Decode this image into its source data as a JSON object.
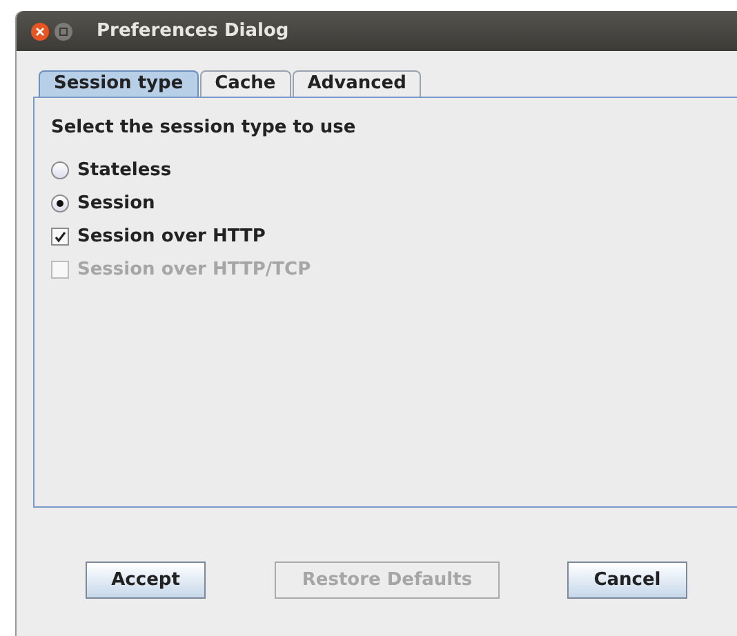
{
  "window": {
    "title": "Preferences Dialog"
  },
  "tabs": [
    {
      "label": "Session type",
      "selected": true
    },
    {
      "label": "Cache",
      "selected": false
    },
    {
      "label": "Advanced",
      "selected": false
    }
  ],
  "panel": {
    "heading": "Select the session type to use",
    "options": [
      {
        "kind": "radio",
        "label": "Stateless",
        "selected": false,
        "disabled": false
      },
      {
        "kind": "radio",
        "label": "Session",
        "selected": true,
        "disabled": false
      },
      {
        "kind": "checkbox",
        "label": "Session over HTTP",
        "checked": true,
        "disabled": false
      },
      {
        "kind": "checkbox",
        "label": "Session over HTTP/TCP",
        "checked": false,
        "disabled": true
      }
    ]
  },
  "buttons": [
    {
      "label": "Accept",
      "disabled": false
    },
    {
      "label": "Restore Defaults",
      "disabled": true
    },
    {
      "label": "Cancel",
      "disabled": false
    }
  ]
}
